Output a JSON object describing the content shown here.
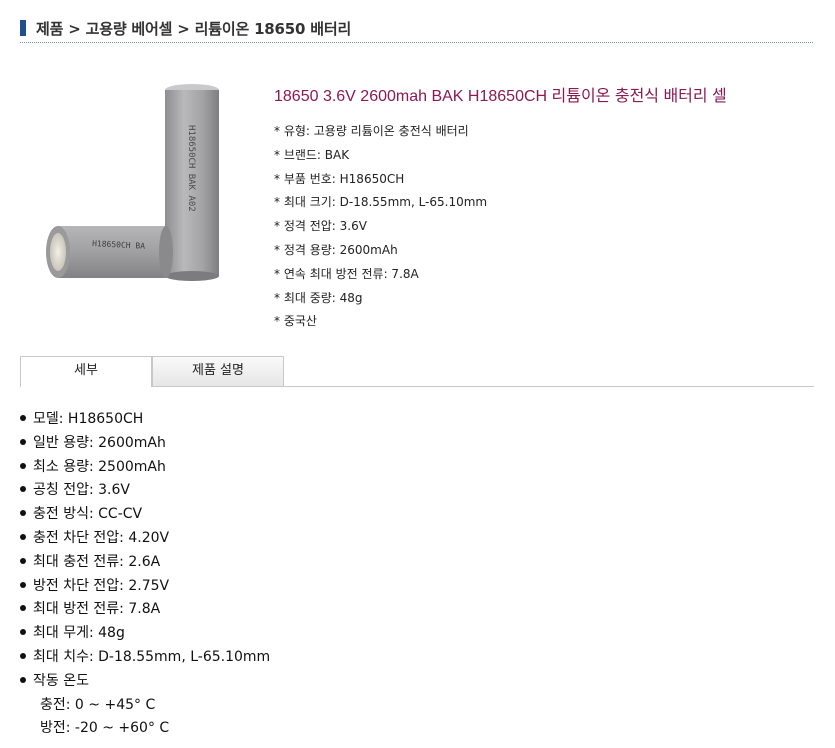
{
  "breadcrumb": "제품 > 고용량 베어셀 > 리튬이온 18650 배터리",
  "product": {
    "title": "18650 3.6V 2600mah BAK H18650CH 리튬이온 충전식 배터리 셀",
    "image_text": {
      "main_cell": "H18650CH  BAK  A02",
      "side_cell": "H18650CH  BA"
    },
    "specs": [
      "* 유형: 고용량 리튬이온 충전식 배터리",
      "* 브랜드: BAK",
      "* 부품 번호: H18650CH",
      "* 최대 크기: D-18.55mm, L-65.10mm",
      "* 정격 전압: 3.6V",
      "* 정격 용량: 2600mAh",
      "* 연속 최대 방전 전류: 7.8A",
      "* 최대 중량: 48g",
      "* 중국산"
    ]
  },
  "tabs": {
    "detail": "세부",
    "description": "제품 설명"
  },
  "details": [
    "모델: H18650CH",
    "일반 용량: 2600mAh",
    "최소 용량: 2500mAh",
    "공칭 전압: 3.6V",
    "충전 방식: CC-CV",
    "충전 차단 전압: 4.20V",
    "최대 충전 전류: 2.6A",
    "방전 차단 전압: 2.75V",
    "최대 방전 전류: 7.8A",
    "최대 무게: 48g",
    "최대 치수: D-18.55mm, L-65.10mm",
    "작동 온도"
  ],
  "operating_temp": [
    "충전: 0 ~ +45° C",
    "방전: -20 ~ +60° C"
  ],
  "colors": {
    "title": "#8b1a54",
    "breadcrumb_mark": "#1f4f8f",
    "cell_body": "#a7a7a9"
  }
}
